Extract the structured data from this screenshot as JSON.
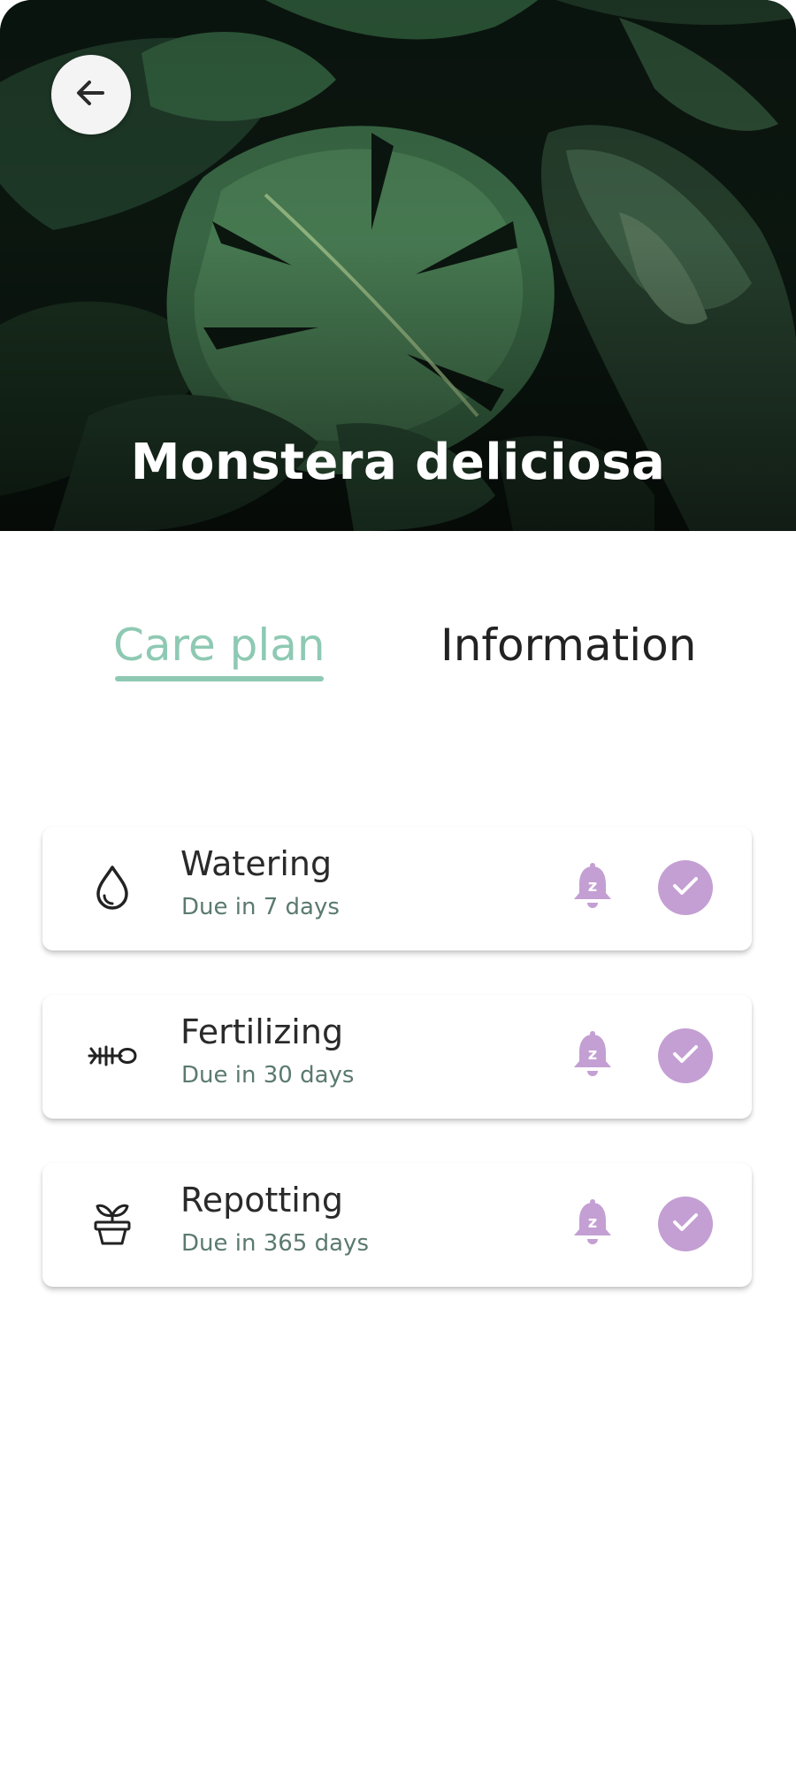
{
  "plant": {
    "name": "Monstera deliciosa"
  },
  "tabs": [
    {
      "label": "Care plan",
      "active": true
    },
    {
      "label": "Information",
      "active": false
    }
  ],
  "care_tasks": [
    {
      "name": "Watering",
      "due": "Due in 7 days",
      "icon": "water-drop-icon"
    },
    {
      "name": "Fertilizing",
      "due": "Due in 30 days",
      "icon": "fertilizer-icon"
    },
    {
      "name": "Repotting",
      "due": "Due in 365 days",
      "icon": "plant-pot-icon"
    }
  ],
  "icons": {
    "back": "arrow-left-icon",
    "snooze": "snooze-bell-icon",
    "done": "check-circle-icon"
  },
  "colors": {
    "accent_green": "#8ec9b3",
    "action_purple": "#c49fd3",
    "text_dark": "#2a2a2a",
    "text_muted": "#5b7a6f"
  }
}
